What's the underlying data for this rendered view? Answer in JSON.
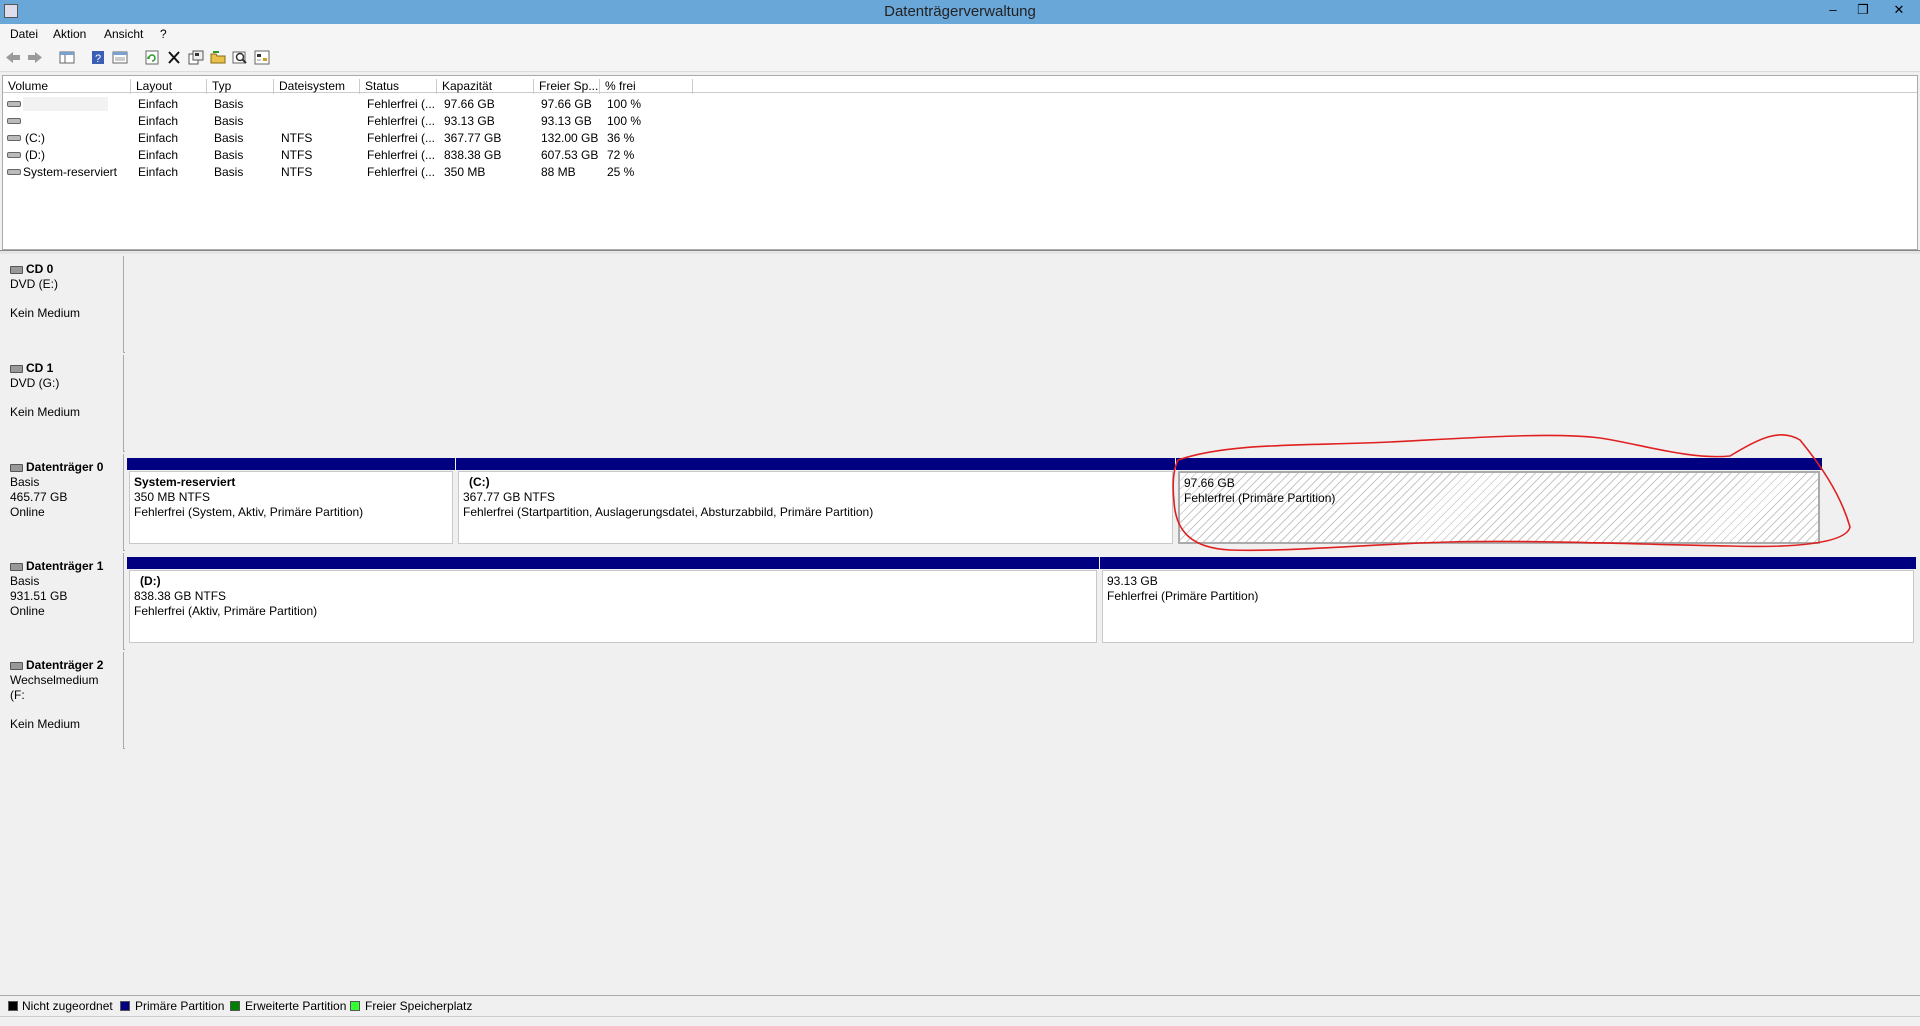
{
  "window": {
    "title": "Datenträgerverwaltung",
    "minimize": "–",
    "maximize": "❐",
    "close": "✕"
  },
  "menu": [
    "Datei",
    "Aktion",
    "Ansicht",
    "?"
  ],
  "toolbar_icons": [
    "back-arrow-icon",
    "forward-arrow-icon",
    "console-tree-icon",
    "help-icon",
    "properties-view-icon",
    "refresh-icon",
    "delete-icon",
    "properties-icon",
    "open-folder-icon",
    "search-icon",
    "settings-icon"
  ],
  "volumes": {
    "columns": [
      "Volume",
      "Layout",
      "Typ",
      "Dateisystem",
      "Status",
      "Kapazität",
      "Freier Sp...",
      "% frei"
    ],
    "rows": [
      {
        "volume": "",
        "layout": "Einfach",
        "typ": "Basis",
        "fs": "",
        "status": "Fehlerfrei (...",
        "cap": "97.66 GB",
        "free": "97.66 GB",
        "pct": "100 %"
      },
      {
        "volume": "",
        "layout": "Einfach",
        "typ": "Basis",
        "fs": "",
        "status": "Fehlerfrei (...",
        "cap": "93.13 GB",
        "free": "93.13 GB",
        "pct": "100 %"
      },
      {
        "volume": "(C:)",
        "layout": "Einfach",
        "typ": "Basis",
        "fs": "NTFS",
        "status": "Fehlerfrei (...",
        "cap": "367.77 GB",
        "free": "132.00 GB",
        "pct": "36 %"
      },
      {
        "volume": "(D:)",
        "layout": "Einfach",
        "typ": "Basis",
        "fs": "NTFS",
        "status": "Fehlerfrei (...",
        "cap": "838.38 GB",
        "free": "607.53 GB",
        "pct": "72 %"
      },
      {
        "volume": "System-reserviert",
        "layout": "Einfach",
        "typ": "Basis",
        "fs": "NTFS",
        "status": "Fehlerfrei (...",
        "cap": "350 MB",
        "free": "88 MB",
        "pct": "25 %"
      }
    ]
  },
  "disks": {
    "cd0": {
      "name": "CD 0",
      "line1": "DVD (E:)",
      "line3": "Kein Medium"
    },
    "cd1": {
      "name": "CD 1",
      "line1": "DVD (G:)",
      "line3": "Kein Medium"
    },
    "disk0": {
      "name": "Datenträger 0",
      "line1": "Basis",
      "line2": "465.77 GB",
      "line3": "Online",
      "partitions": [
        {
          "name": "System-reserviert",
          "size": "350 MB NTFS",
          "status": "Fehlerfrei (System, Aktiv, Primäre Partition)"
        },
        {
          "name": "(C:)",
          "size": "367.77 GB NTFS",
          "status": "Fehlerfrei (Startpartition, Auslagerungsdatei, Absturzabbild, Primäre Partition)"
        },
        {
          "name": "",
          "size": "97.66 GB",
          "status": "Fehlerfrei (Primäre Partition)"
        }
      ]
    },
    "disk1": {
      "name": "Datenträger 1",
      "line1": "Basis",
      "line2": "931.51 GB",
      "line3": "Online",
      "partitions": [
        {
          "name": "(D:)",
          "size": "838.38 GB NTFS",
          "status": "Fehlerfrei (Aktiv, Primäre Partition)"
        },
        {
          "name": "",
          "size": "93.13 GB",
          "status": "Fehlerfrei (Primäre Partition)"
        }
      ]
    },
    "disk2": {
      "name": "Datenträger 2",
      "line1": "Wechselmedium (F:",
      "line3": "Kein Medium"
    }
  },
  "legend": [
    {
      "label": "Nicht zugeordnet",
      "color": "#000000"
    },
    {
      "label": "Primäre Partition",
      "color": "#000080"
    },
    {
      "label": "Erweiterte Partition",
      "color": "#008000"
    },
    {
      "label": "Freier Speicherplatz",
      "color": "#33ff33"
    }
  ]
}
